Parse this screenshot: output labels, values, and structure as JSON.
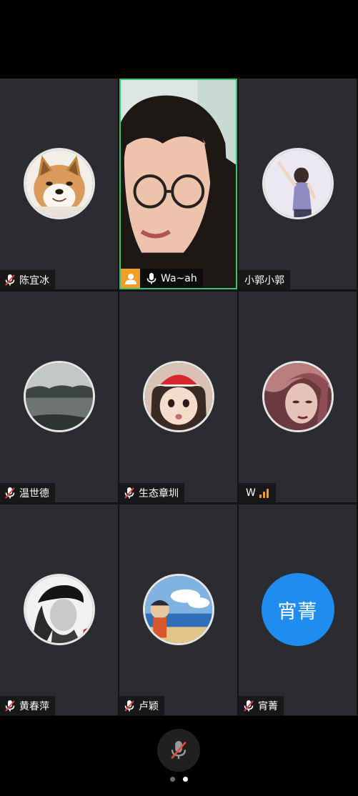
{
  "participants": [
    {
      "name": "陈宜冰",
      "mic": "muted",
      "avatar": "shiba-dog-photo"
    },
    {
      "name": "Wa~ah",
      "mic": "on",
      "video": true,
      "host": true,
      "avatar": "host-person-icon"
    },
    {
      "name": "小郭小郭",
      "avatar": "girl-illustration"
    },
    {
      "name": "温世德",
      "mic": "muted",
      "avatar": "lake-photo"
    },
    {
      "name": "生态章圳",
      "mic": "muted",
      "avatar": "child-santa-hat-photo"
    },
    {
      "name": "W",
      "signal": "weak",
      "avatar": "painted-woman-portrait"
    },
    {
      "name": "黄春萍",
      "mic": "muted",
      "avatar": "man-with-cap-photo"
    },
    {
      "name": "卢颖",
      "mic": "muted",
      "avatar": "cartoon-beach-drawing"
    },
    {
      "name": "宵菁",
      "mic": "muted",
      "avatar_text": "宵菁",
      "avatar_color": "#1f8cf0"
    }
  ],
  "controls": {
    "mic_button": "muted-mic-icon"
  },
  "pager": {
    "pages": 2,
    "current": 2
  },
  "colors": {
    "active_border": "#32c86e",
    "muted_red": "#e84545",
    "host_badge": "#f39c28",
    "signal": "#f39c28",
    "tile_bg": "#2b2c2f",
    "text_avatar_bg": "#1f8cf0"
  }
}
